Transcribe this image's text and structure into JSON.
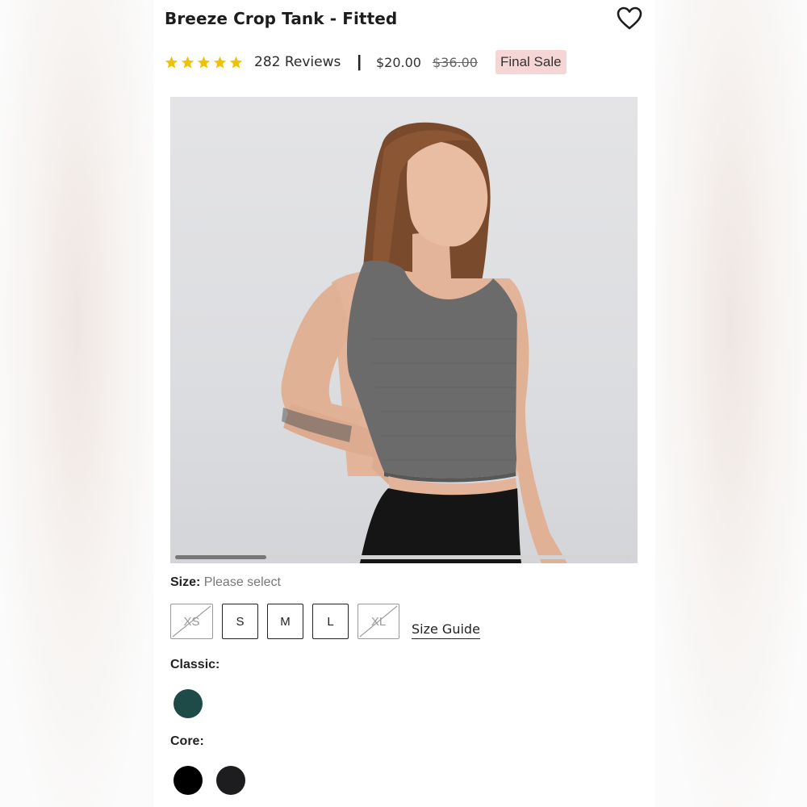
{
  "product": {
    "title": "Breeze Crop Tank - Fitted",
    "reviews_text": "282 Reviews",
    "rating": 5,
    "separator": "|",
    "price": "$20.00",
    "old_price": "$36.00",
    "badge": "Final Sale"
  },
  "gallery": {
    "scroll_progress": 0.2
  },
  "size": {
    "label": "Size:",
    "placeholder": "Please select",
    "options": [
      {
        "label": "XS",
        "available": false
      },
      {
        "label": "S",
        "available": true
      },
      {
        "label": "M",
        "available": true
      },
      {
        "label": "L",
        "available": true
      },
      {
        "label": "XL",
        "available": false
      }
    ],
    "guide_label": "Size Guide"
  },
  "colors": {
    "classic_label": "Classic:",
    "classic": [
      "#1e4a48"
    ],
    "core_label": "Core:",
    "core": [
      "#000000",
      "#1d1d1f"
    ]
  },
  "palette": {
    "star": "#f2c200",
    "badge_bg": "#f6d5d6",
    "tank": "#6b6b6b",
    "leggings": "#151515"
  }
}
